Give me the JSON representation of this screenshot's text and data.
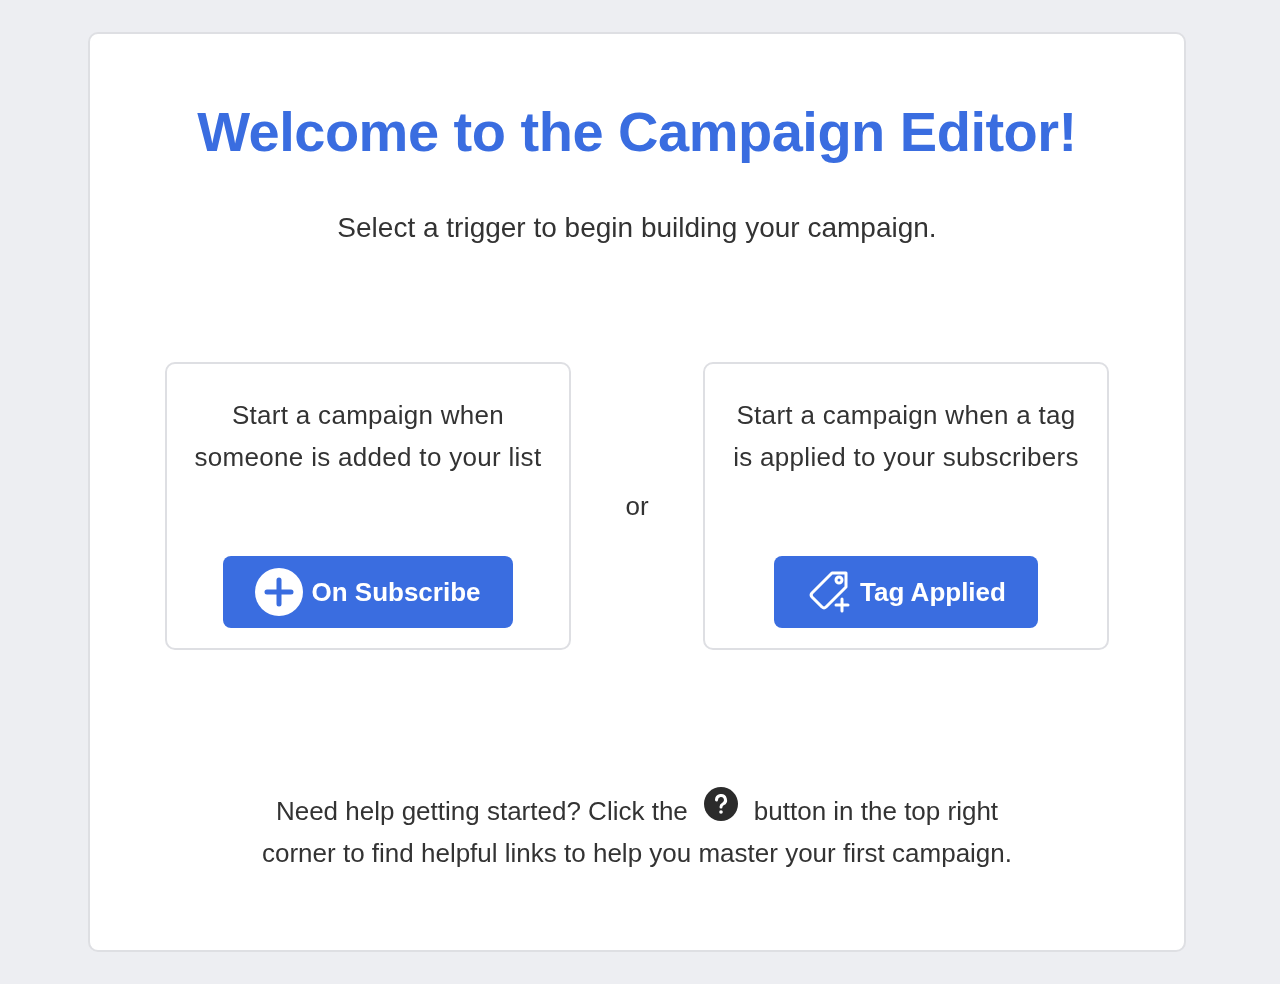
{
  "title": "Welcome to the Campaign Editor!",
  "subtitle": "Select a trigger to begin building your campaign.",
  "triggers": [
    {
      "kind": "subscribe",
      "description": "Start a campaign when someone is added to your list",
      "button": "On Subscribe"
    },
    {
      "kind": "tag",
      "description": "Start a campaign when a tag is applied to your subscribers",
      "button": "Tag Applied"
    }
  ],
  "separator": "or",
  "help": {
    "before": "Need help getting started? Click the",
    "after": "button in the top right",
    "second_line": "corner to find helpful links to help you master your first campaign."
  }
}
